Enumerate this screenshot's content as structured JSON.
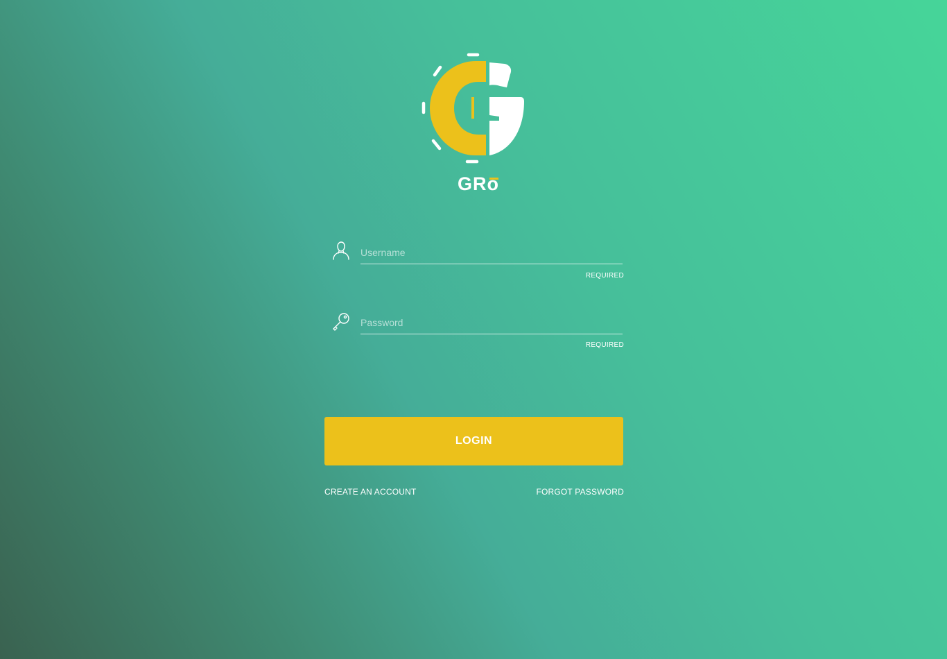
{
  "brand": {
    "name": "GRō",
    "name_main": "GRO",
    "accent_color": "#ecc11b",
    "logo_icon": "gro-g-logo"
  },
  "form": {
    "username": {
      "placeholder": "Username",
      "value": "",
      "hint": "REQUIRED",
      "icon": "user-icon"
    },
    "password": {
      "placeholder": "Password",
      "value": "",
      "hint": "REQUIRED",
      "icon": "key-icon"
    },
    "login_label": "LOGIN"
  },
  "links": {
    "create_account": "CREATE AN ACCOUNT",
    "forgot_password": "FORGOT PASSWORD"
  },
  "colors": {
    "button": "#ecc11b",
    "text": "#ffffff",
    "gradient_dark": "#3a6250",
    "gradient_light": "#46d599"
  }
}
